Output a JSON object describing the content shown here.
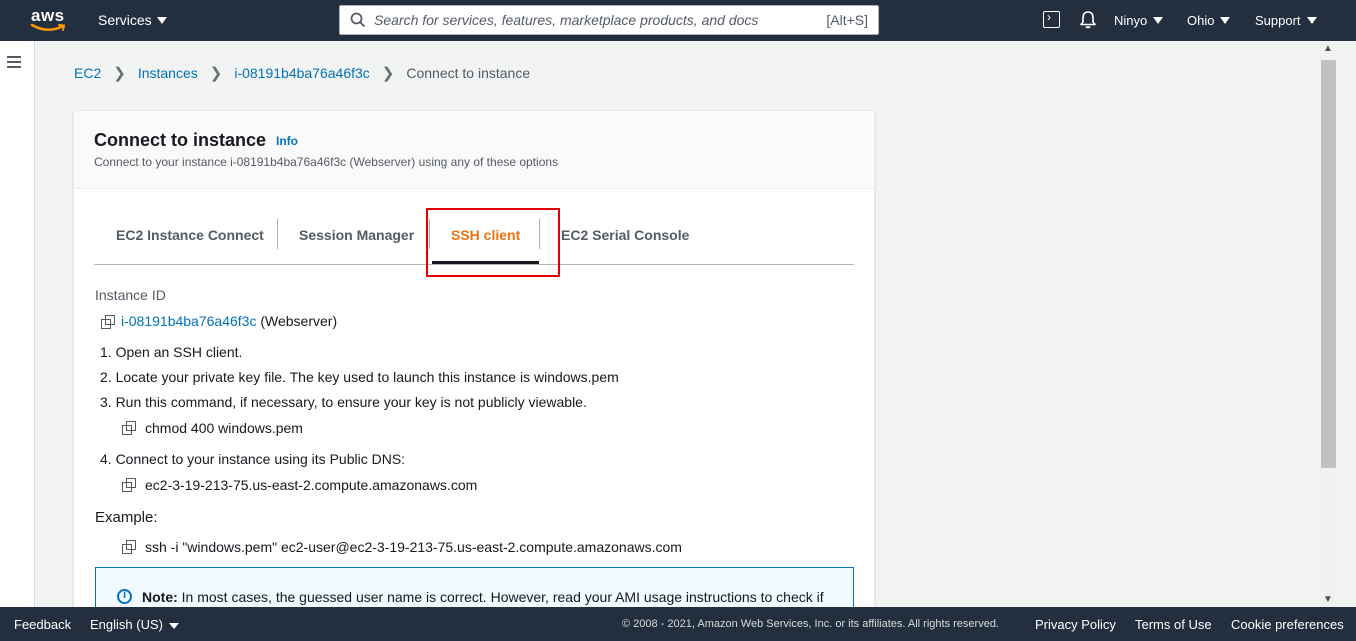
{
  "topnav": {
    "logo_text": "aws",
    "services_label": "Services",
    "search_placeholder": "Search for services, features, marketplace products, and docs",
    "search_shortcut": "[Alt+S]",
    "user_label": "Ninyo",
    "region_label": "Ohio",
    "support_label": "Support"
  },
  "breadcrumb": {
    "items": [
      "EC2",
      "Instances",
      "i-08191b4ba76a46f3c"
    ],
    "current": "Connect to instance"
  },
  "panel": {
    "title": "Connect to instance",
    "info_label": "Info",
    "description": "Connect to your instance i-08191b4ba76a46f3c (Webserver) using any of these options"
  },
  "tabs": [
    {
      "label": "EC2 Instance Connect"
    },
    {
      "label": "Session Manager"
    },
    {
      "label": "SSH client"
    },
    {
      "label": "EC2 Serial Console"
    }
  ],
  "active_tab": "SSH client",
  "ssh": {
    "instance_id_label": "Instance ID",
    "instance_id": "i-08191b4ba76a46f3c",
    "instance_name": "(Webserver)",
    "steps": [
      "1. Open an SSH client.",
      "2. Locate your private key file. The key used to launch this instance is windows.pem",
      "3. Run this command, if necessary, to ensure your key is not publicly viewable.",
      "4. Connect to your instance using its Public DNS:"
    ],
    "chmod_command": "chmod 400 windows.pem",
    "public_dns": "ec2-3-19-213-75.us-east-2.compute.amazonaws.com",
    "example_label": "Example:",
    "example_command": "ssh -i \"windows.pem\" ec2-user@ec2-3-19-213-75.us-east-2.compute.amazonaws.com",
    "note_bold": "Note:",
    "note_text": " In most cases, the guessed user name is correct. However, read your AMI usage instructions to check if"
  },
  "footer": {
    "feedback": "Feedback",
    "language": "English (US)",
    "copyright": "© 2008 - 2021, Amazon Web Services, Inc. or its affiliates. All rights reserved.",
    "privacy": "Privacy Policy",
    "terms": "Terms of Use",
    "cookies": "Cookie preferences"
  },
  "colors": {
    "nav_bg": "#232f3e",
    "link": "#0073bb",
    "active_tab": "#ec7211",
    "highlight": "#e00000"
  },
  "icons": [
    "search-icon",
    "cloudshell-icon",
    "bell-icon",
    "menu-icon",
    "copy-icon",
    "info-circle-icon",
    "chevron-right-icon",
    "caret-down-icon"
  ]
}
